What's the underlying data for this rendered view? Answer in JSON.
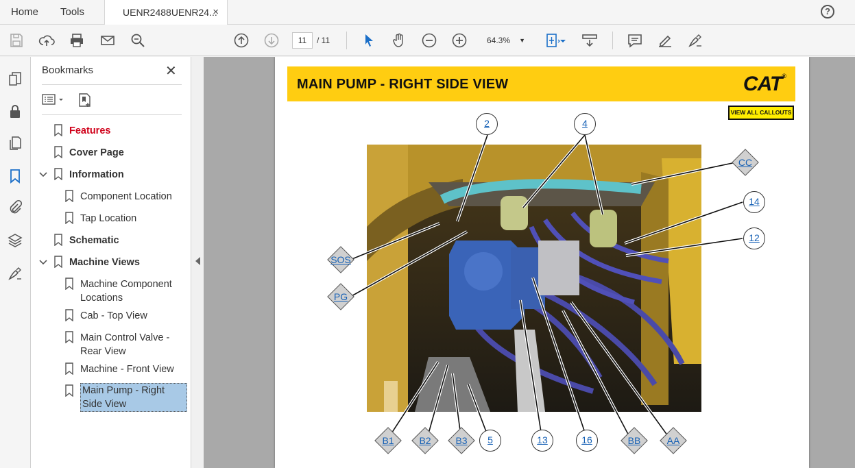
{
  "menu": {
    "home": "Home",
    "tools": "Tools"
  },
  "tab": {
    "title": "UENR2488UENR24...",
    "close": "×"
  },
  "help": "?",
  "toolbar": {
    "page_current": "11",
    "page_total": "/  11",
    "zoom": "64.3%"
  },
  "bookmarks": {
    "title": "Bookmarks",
    "items": [
      {
        "label": "Features"
      },
      {
        "label": "Cover Page"
      },
      {
        "label": "Information"
      },
      {
        "label": "Component Location"
      },
      {
        "label": "Tap Location"
      },
      {
        "label": "Schematic"
      },
      {
        "label": "Machine Views"
      },
      {
        "label": "Machine Component Locations"
      },
      {
        "label": "Cab - Top View"
      },
      {
        "label": "Main Control Valve - Rear View"
      },
      {
        "label": "Machine - Front View"
      },
      {
        "label": "Main Pump - Right Side View"
      }
    ]
  },
  "document": {
    "header_title": "MAIN PUMP - RIGHT SIDE VIEW",
    "logo": "CAT",
    "logo_mark": "®",
    "callouts_button": "VIEW ALL CALLOUTS",
    "callouts": {
      "c2": "2",
      "c4": "4",
      "c14": "14",
      "c12": "12",
      "c5": "5",
      "c13": "13",
      "c16": "16",
      "cc": "CC",
      "sos": "SOS",
      "pg": "PG",
      "b1": "B1",
      "b2": "B2",
      "b3": "B3",
      "bb": "BB",
      "aa": "AA"
    }
  },
  "colors": {
    "cat_yellow": "#ffcd11",
    "link_blue": "#1560b5",
    "selection": "#a8c9e6",
    "bookmark_red": "#d0021b"
  }
}
